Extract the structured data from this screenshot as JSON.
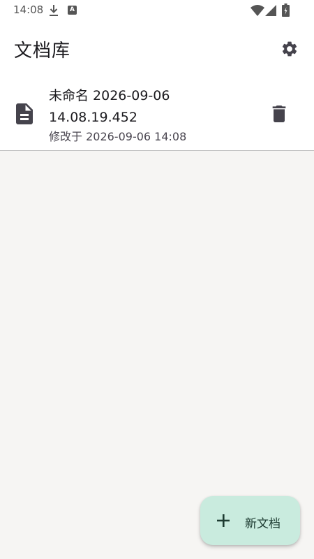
{
  "status_bar": {
    "time": "14:08",
    "icons": [
      "download-icon",
      "a-notification-icon",
      "wifi-icon",
      "signal-icon",
      "battery-icon"
    ]
  },
  "app_bar": {
    "title": "文档库",
    "settings_icon": "gear-icon"
  },
  "documents": [
    {
      "icon": "document-icon",
      "title": "未命名 2026-09-06 14.08.19.452",
      "modified": "修改于 2026-09-06 14:08",
      "delete_icon": "trash-icon"
    }
  ],
  "fab": {
    "icon": "plus-icon",
    "label": "新文档"
  },
  "colors": {
    "background": "#f6f5f3",
    "surface": "#ffffff",
    "fab": "#c9ebde",
    "icon": "#45434c"
  }
}
